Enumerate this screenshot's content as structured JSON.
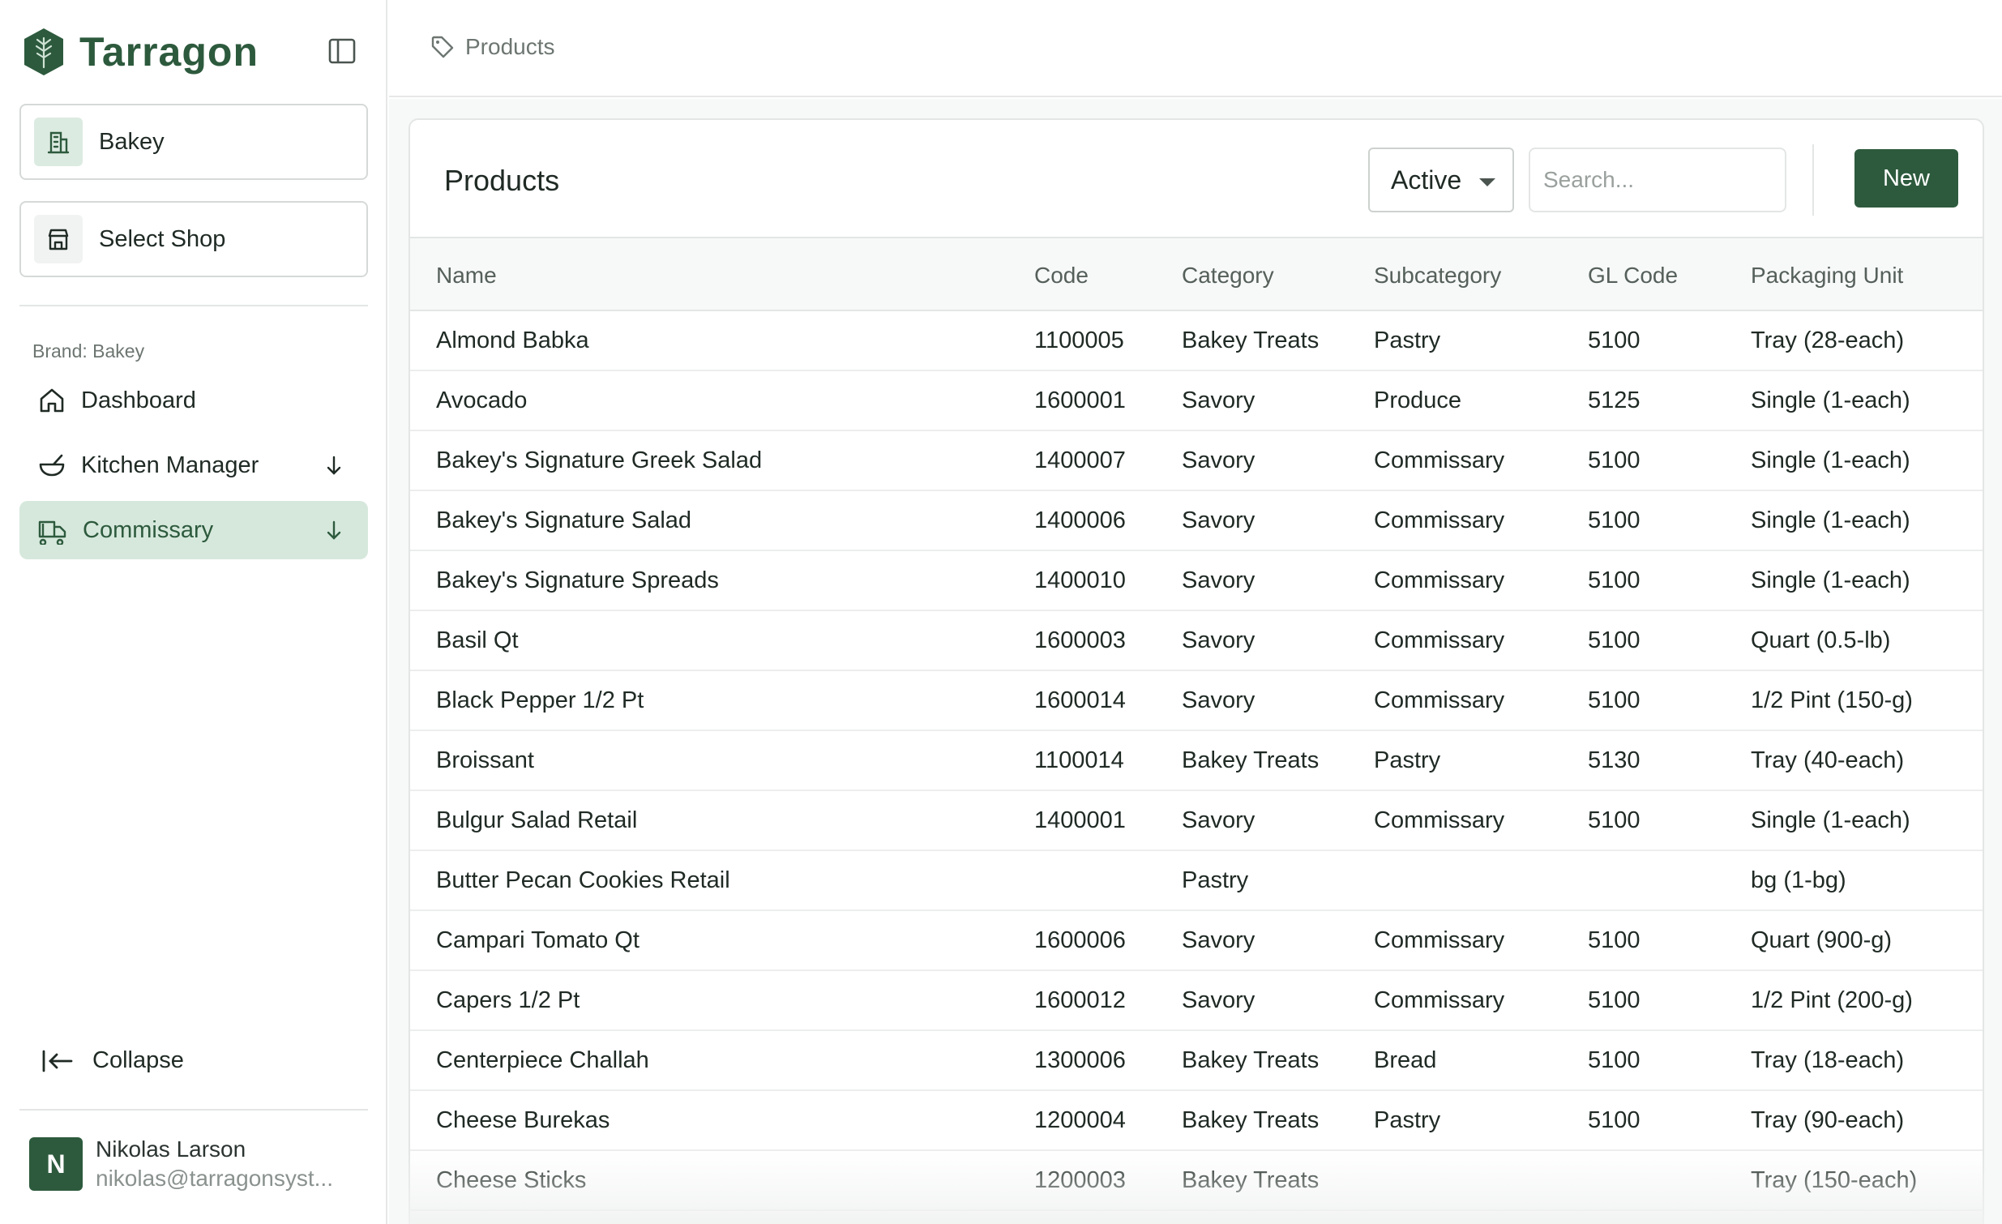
{
  "app": {
    "name": "Tarragon"
  },
  "sidebar": {
    "shop_current": "Bakey",
    "shop_select": "Select Shop",
    "brand_label": "Brand: Bakey",
    "nav": [
      {
        "label": "Dashboard",
        "icon": "home-icon"
      },
      {
        "label": "Kitchen Manager",
        "icon": "bowl-icon",
        "expandable": true
      },
      {
        "label": "Commissary",
        "icon": "truck-icon",
        "expandable": true,
        "active": true
      }
    ],
    "collapse_label": "Collapse",
    "user": {
      "initial": "N",
      "name": "Nikolas Larson",
      "email": "nikolas@tarragonsyst..."
    }
  },
  "breadcrumb": {
    "label": "Products",
    "icon": "tag-icon"
  },
  "products": {
    "title": "Products",
    "status_filter": "Active",
    "search_placeholder": "Search...",
    "new_label": "New",
    "columns": [
      "Name",
      "Code",
      "Category",
      "Subcategory",
      "GL Code",
      "Packaging Unit"
    ],
    "rows": [
      [
        "Almond Babka",
        "1100005",
        "Bakey Treats",
        "Pastry",
        "5100",
        "Tray (28-each)"
      ],
      [
        "Avocado",
        "1600001",
        "Savory",
        "Produce",
        "5125",
        "Single (1-each)"
      ],
      [
        "Bakey's Signature Greek Salad",
        "1400007",
        "Savory",
        "Commissary",
        "5100",
        "Single (1-each)"
      ],
      [
        "Bakey's Signature Salad",
        "1400006",
        "Savory",
        "Commissary",
        "5100",
        "Single (1-each)"
      ],
      [
        "Bakey's Signature Spreads",
        "1400010",
        "Savory",
        "Commissary",
        "5100",
        "Single (1-each)"
      ],
      [
        "Basil Qt",
        "1600003",
        "Savory",
        "Commissary",
        "5100",
        "Quart (0.5-lb)"
      ],
      [
        "Black Pepper 1/2 Pt",
        "1600014",
        "Savory",
        "Commissary",
        "5100",
        "1/2 Pint (150-g)"
      ],
      [
        "Broissant",
        "1100014",
        "Bakey Treats",
        "Pastry",
        "5130",
        "Tray (40-each)"
      ],
      [
        "Bulgur Salad Retail",
        "1400001",
        "Savory",
        "Commissary",
        "5100",
        "Single (1-each)"
      ],
      [
        "Butter Pecan Cookies Retail",
        "",
        "Pastry",
        "",
        "",
        "bg (1-bg)"
      ],
      [
        "Campari Tomato Qt",
        "1600006",
        "Savory",
        "Commissary",
        "5100",
        "Quart (900-g)"
      ],
      [
        "Capers 1/2 Pt",
        "1600012",
        "Savory",
        "Commissary",
        "5100",
        "1/2 Pint (200-g)"
      ],
      [
        "Centerpiece Challah",
        "1300006",
        "Bakey Treats",
        "Bread",
        "5100",
        "Tray (18-each)"
      ],
      [
        "Cheese Burekas",
        "1200004",
        "Bakey Treats",
        "Pastry",
        "5100",
        "Tray (90-each)"
      ],
      [
        "Cheese Sticks",
        "1200003",
        "Bakey Treats",
        "",
        "",
        "Tray (150-each)"
      ]
    ]
  },
  "colors": {
    "brand": "#2d5a3d",
    "active_nav_bg": "#d6e8dc"
  }
}
